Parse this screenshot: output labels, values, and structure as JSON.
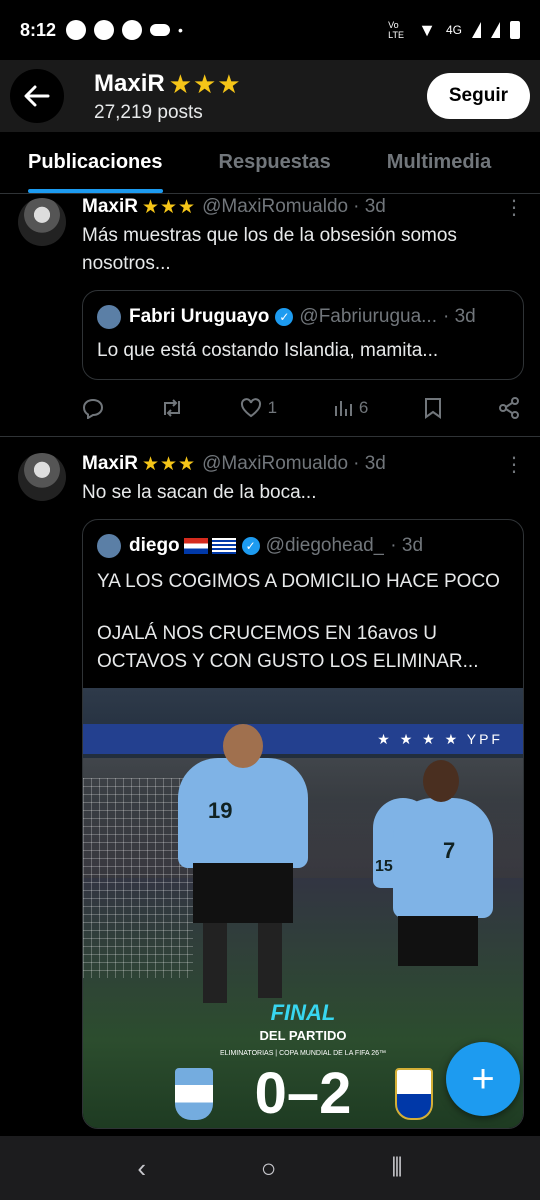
{
  "status_bar": {
    "time": "8:12",
    "network": "4G",
    "volte": "Vo LTE"
  },
  "header": {
    "title": "MaxiR",
    "stars": "★★★",
    "subtitle": "27,219 posts",
    "follow_label": "Seguir"
  },
  "tabs": [
    {
      "label": "Publicaciones",
      "active": true
    },
    {
      "label": "Respuestas",
      "active": false
    },
    {
      "label": "Multimedia",
      "active": false
    }
  ],
  "posts": [
    {
      "name": "MaxiR",
      "stars": "★★★",
      "handle": "@MaxiRomualdo",
      "time": "· 3d",
      "text": "Más muestras que los de la obsesión somos nosotros...",
      "quote": {
        "name": "Fabri Uruguayo",
        "handle": "@Fabriurugua...",
        "time": "· 3d",
        "text": "Lo que está costando Islandia, mamita..."
      },
      "actions": {
        "reply": "",
        "repost": "",
        "likes": "1",
        "views": "6"
      }
    },
    {
      "name": "MaxiR",
      "stars": "★★★",
      "handle": "@MaxiRomualdo",
      "time": "· 3d",
      "text": "No se la sacan de la boca...",
      "quote": {
        "name": "diego",
        "handle": "@diegohead_",
        "time": "· 3d",
        "text_line1": "YA LOS COGIMOS A DOMICILIO HACE POCO",
        "text_line2": "OJALÁ NOS CRUCEMOS EN 16avos U OCTAVOS Y CON GUSTO LOS ELIMINAR...",
        "image": {
          "banner": "★ ★ ★ ★ YPF",
          "final": "FINAL",
          "final_sub": "DEL PARTIDO",
          "final_note": "ELIMINATORIAS | COPA MUNDIAL DE LA FIFA 26™",
          "score": "0–2",
          "number_left": "19",
          "number_right": "7",
          "number_back": "15"
        }
      }
    }
  ],
  "fab": {
    "icon": "plus-icon",
    "label": "+"
  },
  "colors": {
    "accent": "#1d9bf0",
    "star": "#f5c518",
    "uruguay_blue": "#7fb3e6"
  }
}
